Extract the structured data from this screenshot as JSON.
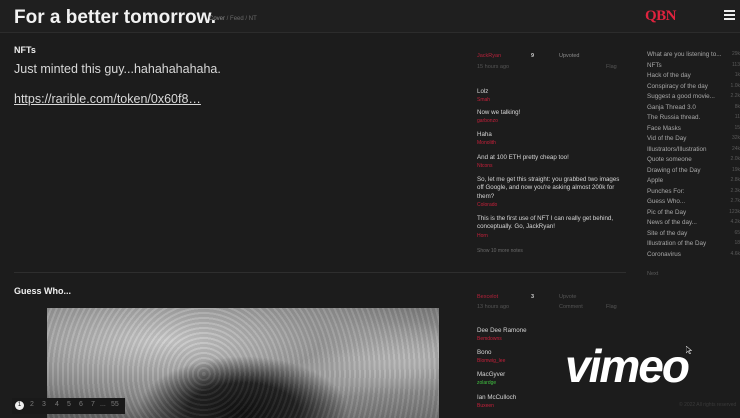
{
  "header": {
    "title": "For a better tomorrow.",
    "breadcrumb": [
      "Cover",
      "Feed",
      "NT"
    ],
    "logo": "QBN",
    "menu_icon": "hamburger-menu-icon",
    "accent_color": "#e0233e"
  },
  "posts": [
    {
      "title": "NFTs",
      "body": "Just minted this guy...hahahahahaha.",
      "link": "https://rarible.com/token/0x60f8…",
      "author": "JackRyan",
      "count": "9",
      "status": "Upvoted",
      "time": "15 hours ago",
      "flag": "Flag",
      "notes": [
        {
          "text": "Lolz",
          "user": "Smah"
        },
        {
          "text": "Now we talking!",
          "user": "garbonzo"
        },
        {
          "text": "Haha",
          "user": "Monolith"
        },
        {
          "text": "And at 100 ETH pretty cheap too!",
          "user": "Ntcons"
        },
        {
          "text": "So, let me get this straight: you grabbed two images off Google, and now you're asking almost 200k for them?",
          "user": "Colorado"
        },
        {
          "text": "This is the first use of NFT I can really get behind, conceptually. Go, JackRyan!",
          "user": "Horn"
        }
      ],
      "show_more": "Show 10 more notes"
    },
    {
      "title": "Guess Who...",
      "author": "Bexcelot",
      "count": "3",
      "status": "Upvote",
      "time": "13 hours ago",
      "comment": "Comment",
      "flag": "Flag",
      "notes": [
        {
          "text": "Dee Dee Ramone",
          "user": "Bemdowns"
        },
        {
          "text": "Bono",
          "user": "Blomwig_lee"
        },
        {
          "text": "MacGyver",
          "user": "zolardge"
        },
        {
          "text": "Ian McCulloch",
          "user": "Buxeen"
        }
      ]
    }
  ],
  "pagination": {
    "pages": [
      "1",
      "2",
      "3",
      "4",
      "5",
      "6",
      "7",
      "...",
      "55"
    ],
    "current": "1"
  },
  "sidebar": {
    "items": [
      {
        "label": "What are you listening to...",
        "count": "29k"
      },
      {
        "label": "NFTs",
        "count": "113"
      },
      {
        "label": "Hack of the day",
        "count": "1k"
      },
      {
        "label": "Conspiracy of the day",
        "count": "1.0k"
      },
      {
        "label": "Suggest a good movie...",
        "count": "2.2k"
      },
      {
        "label": "Ganja Thread 3.0",
        "count": "8k"
      },
      {
        "label": "The Russia thread.",
        "count": "11"
      },
      {
        "label": "Face Masks",
        "count": "15"
      },
      {
        "label": "Vid of the Day",
        "count": "32k"
      },
      {
        "label": "Illustrators/Illustration",
        "count": "24k"
      },
      {
        "label": "Quote someone",
        "count": "2.0k"
      },
      {
        "label": "Drawing of the Day",
        "count": "19k"
      },
      {
        "label": "Apple",
        "count": "2.8k"
      },
      {
        "label": "Punches For:",
        "count": "2.3k"
      },
      {
        "label": "Guess Who...",
        "count": "2.7k"
      },
      {
        "label": "Pic of the Day",
        "count": "123k"
      },
      {
        "label": "News of the day...",
        "count": "4.2k"
      },
      {
        "label": "Site of the day",
        "count": "65"
      },
      {
        "label": "Illustration of the Day",
        "count": "18"
      },
      {
        "label": "Coronavirus",
        "count": "4.6k"
      }
    ],
    "next": "Next"
  },
  "overlay": {
    "watermark": "vimeo",
    "footer": "© 2022 All rights reserved"
  }
}
